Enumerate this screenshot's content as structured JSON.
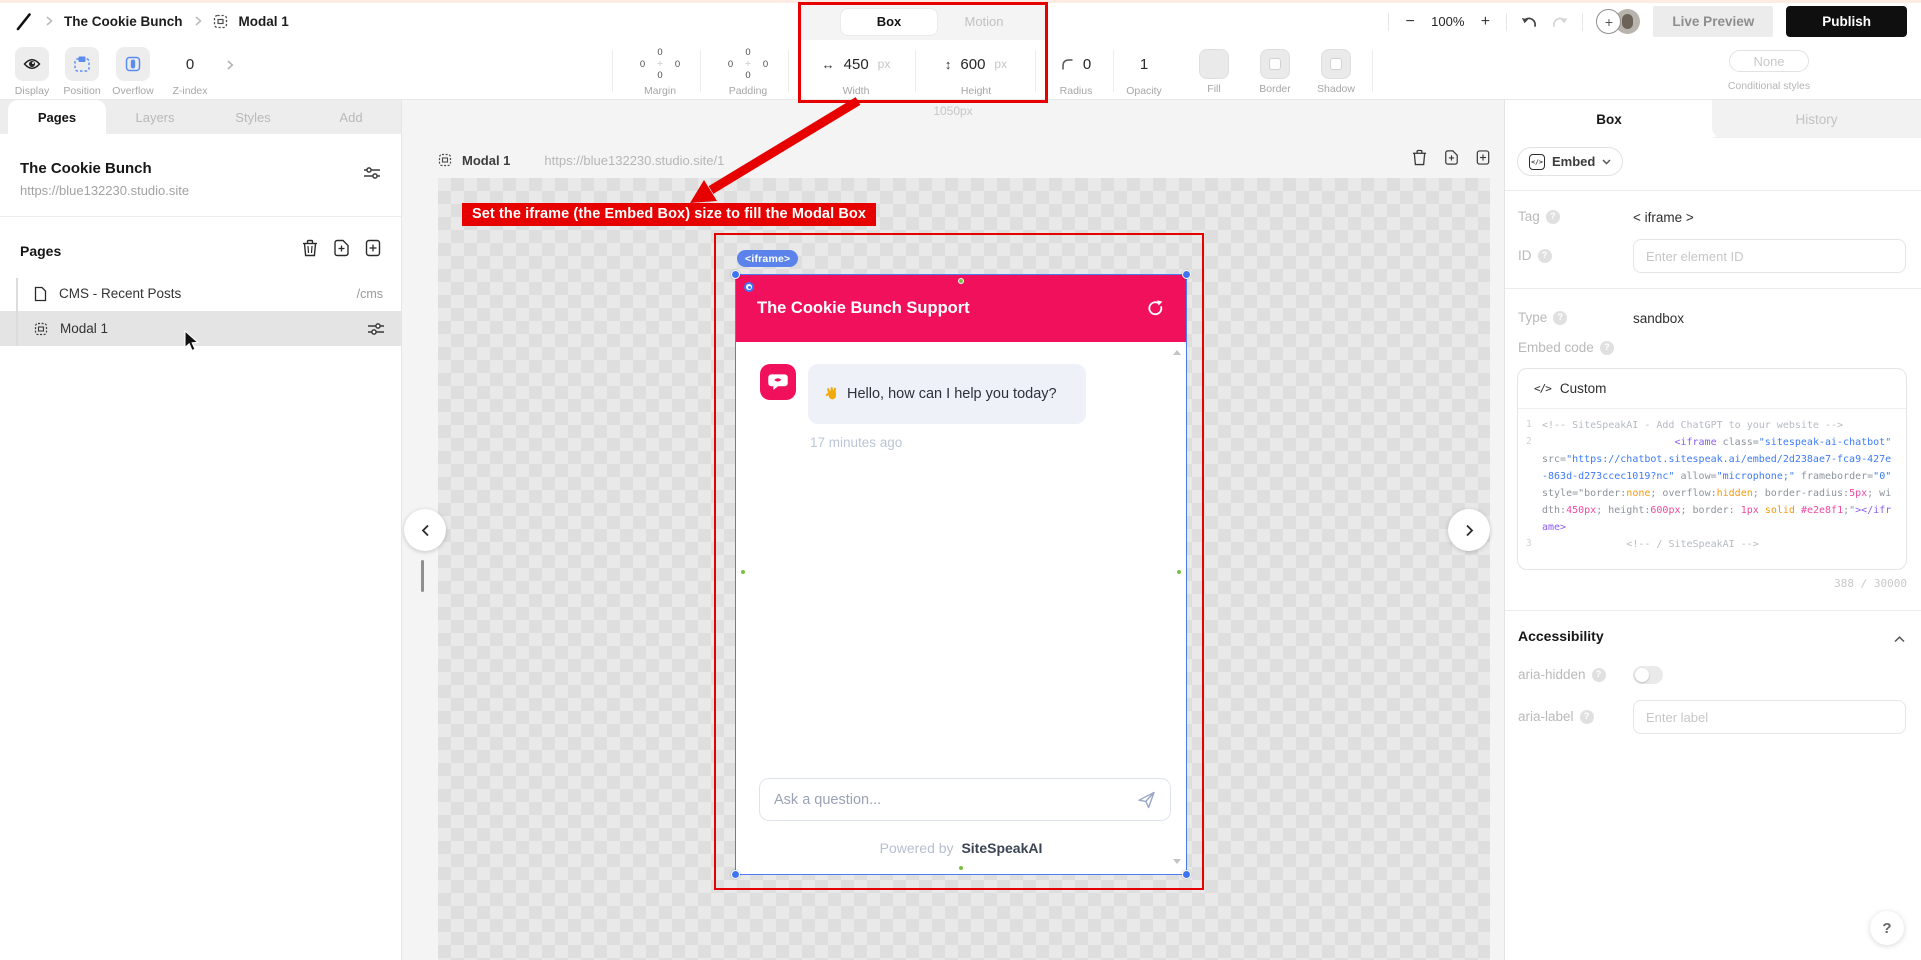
{
  "topbar": {
    "breadcrumb": {
      "site": "The Cookie Bunch",
      "page": "Modal 1"
    },
    "tabs": {
      "box": "Box",
      "motion": "Motion"
    },
    "zoom": {
      "minus": "−",
      "level": "100%",
      "plus": "+"
    },
    "invite_plus": "+",
    "live_preview": "Live Preview",
    "publish": "Publish"
  },
  "toolbar": {
    "display": {
      "label": "Display"
    },
    "position": {
      "label": "Position"
    },
    "overflow": {
      "label": "Overflow"
    },
    "zindex": {
      "value": "0",
      "label": "Z-index"
    },
    "margin": {
      "label": "Margin",
      "top": "0",
      "right": "0",
      "bottom": "0",
      "left": "0",
      "plus": "+"
    },
    "padding": {
      "label": "Padding",
      "top": "0",
      "right": "0",
      "bottom": "0",
      "left": "0",
      "plus": "+"
    },
    "width": {
      "arrow": "↔",
      "value": "450",
      "unit": "px",
      "label": "Width"
    },
    "height": {
      "arrow": "↕",
      "value": "600",
      "unit": "px",
      "label": "Height"
    },
    "radius": {
      "value": "0",
      "label": "Radius"
    },
    "opacity": {
      "value": "1",
      "label": "Opacity"
    },
    "fill": {
      "label": "Fill"
    },
    "border": {
      "label": "Border"
    },
    "shadow": {
      "label": "Shadow"
    },
    "conditional": {
      "button": "None",
      "label": "Conditional styles"
    }
  },
  "sidebar": {
    "tabs": [
      {
        "label": "Pages"
      },
      {
        "label": "Layers"
      },
      {
        "label": "Styles"
      },
      {
        "label": "Add"
      }
    ],
    "site": {
      "name": "The Cookie Bunch",
      "url": "https://blue132230.studio.site"
    },
    "pages_header": "Pages",
    "pages": [
      {
        "label": "CMS - Recent Posts",
        "path": "/cms"
      },
      {
        "label": "Modal 1"
      }
    ]
  },
  "canvas": {
    "width_label": "1050px",
    "page_header": {
      "title": "Modal 1",
      "url": "https://blue132230.studio.site/1"
    },
    "annotation": "Set the iframe (the Embed Box) size to fill the Modal Box",
    "iframe_badge": "<iframe>",
    "chatbot": {
      "title": "The Cookie Bunch Support",
      "message_emoji": "👋",
      "message_text": "Hello, how can I help you today?",
      "time": "17 minutes ago",
      "input_placeholder": "Ask a question...",
      "footer_prefix": "Powered by",
      "footer_brand": "SiteSpeakAI"
    }
  },
  "inspector": {
    "tabs": {
      "box": "Box",
      "history": "History"
    },
    "element_menu": "Embed",
    "tag": {
      "label": "Tag",
      "value": "< iframe >"
    },
    "id": {
      "label": "ID",
      "placeholder": "Enter element ID"
    },
    "type": {
      "label": "Type",
      "value": "sandbox"
    },
    "embed_code": {
      "label": "Embed code",
      "mode": "Custom",
      "counter": "388 / 30000",
      "lines": [
        {
          "num": "1",
          "tokens": [
            {
              "t": "<!-- SiteSpeakAI - Add ChatGPT to your website -->",
              "c": "cm"
            }
          ]
        },
        {
          "num": "2",
          "tokens": [
            {
              "t": "                      ",
              "c": "pl"
            },
            {
              "t": "<iframe",
              "c": "tag"
            },
            {
              "t": " ",
              "c": "pl"
            },
            {
              "t": "class=",
              "c": "attr"
            },
            {
              "t": "\"sitespeak-ai-chatbot\"",
              "c": "str"
            },
            {
              "t": " ",
              "c": "pl"
            },
            {
              "t": "src=",
              "c": "attr"
            },
            {
              "t": "\"https://chatbot.sitespeak.ai/embed/2d238ae7-fca9-427e-863d-d273ccec1019?nc\"",
              "c": "str"
            },
            {
              "t": " ",
              "c": "pl"
            },
            {
              "t": "allow=",
              "c": "attr"
            },
            {
              "t": "\"microphone;\"",
              "c": "str"
            },
            {
              "t": " ",
              "c": "pl"
            },
            {
              "t": "frameborder=",
              "c": "attr"
            },
            {
              "t": "\"0\"",
              "c": "str"
            },
            {
              "t": " ",
              "c": "pl"
            },
            {
              "t": "style=",
              "c": "attr"
            },
            {
              "t": "\"border:",
              "c": "attr"
            },
            {
              "t": "none",
              "c": "kw"
            },
            {
              "t": "; overflow:",
              "c": "attr"
            },
            {
              "t": "hidden",
              "c": "kw"
            },
            {
              "t": "; border-radius:",
              "c": "attr"
            },
            {
              "t": "5px",
              "c": "num"
            },
            {
              "t": "; width:",
              "c": "attr"
            },
            {
              "t": "450px",
              "c": "num"
            },
            {
              "t": "; height:",
              "c": "attr"
            },
            {
              "t": "600px",
              "c": "num"
            },
            {
              "t": "; border: ",
              "c": "attr"
            },
            {
              "t": "1px",
              "c": "num"
            },
            {
              "t": " ",
              "c": "pl"
            },
            {
              "t": "solid",
              "c": "kw"
            },
            {
              "t": " ",
              "c": "pl"
            },
            {
              "t": "#e2e8f1",
              "c": "num"
            },
            {
              "t": ";\"",
              "c": "attr"
            },
            {
              "t": "></iframe>",
              "c": "tag"
            }
          ]
        },
        {
          "num": "3",
          "tokens": [
            {
              "t": "              <!-- / SiteSpeakAI -->",
              "c": "cm"
            }
          ]
        }
      ]
    },
    "accessibility": {
      "title": "Accessibility",
      "aria_hidden_label": "aria-hidden",
      "aria_label_label": "aria-label",
      "aria_label_placeholder": "Enter label"
    }
  },
  "help_label": "?",
  "colors": {
    "brand_pink": "#f1105c",
    "annotation_red": "#e60000",
    "selection_blue": "#4a7df2",
    "badge_blue": "#5b83eb",
    "publish_black": "#0f0f0f"
  }
}
